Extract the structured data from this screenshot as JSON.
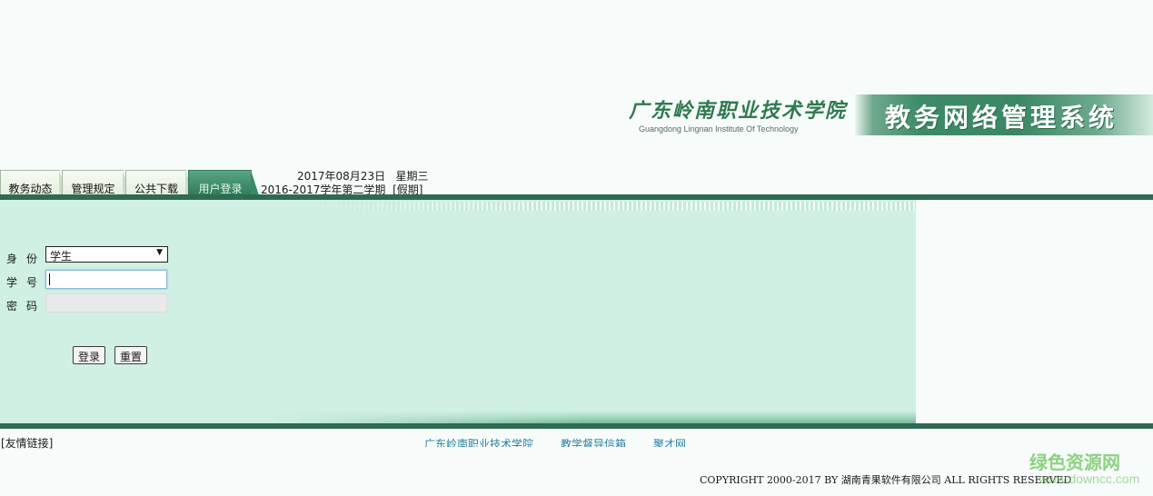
{
  "header": {
    "school_name": "广东岭南职业技术学院",
    "school_name_en": "Guangdong Lingnan Institute Of Technology",
    "system_title": "教务网络管理系统"
  },
  "nav": {
    "tabs": [
      {
        "label": "教务动态",
        "active": false
      },
      {
        "label": "管理规定",
        "active": false
      },
      {
        "label": "公共下载",
        "active": false
      },
      {
        "label": "用户登录",
        "active": true
      }
    ],
    "date": "2017年08月23日",
    "weekday": "星期三",
    "term": "2016-2017学年第二学期",
    "term_status": "[假期]"
  },
  "login": {
    "identity_label": "身份",
    "identity_value": "学生",
    "student_id_label": "学号",
    "student_id_value": "",
    "password_label": "密码",
    "password_value": "",
    "login_button": "登录",
    "reset_button": "重置"
  },
  "footer": {
    "friend_links_label": "[友情链接]",
    "links": [
      "广东岭南职业技术学院",
      "教学督导信箱",
      "聚才网"
    ],
    "copyright_prefix": "COPYRIGHT 2000-2017 BY ",
    "copyright_company": "湖南青果软件有限公司",
    "copyright_suffix": " ALL RIGHTS RESERVED"
  },
  "watermark": {
    "name": "绿色资源网",
    "url": "www.downcc.com"
  },
  "colors": {
    "brand_green": "#2f7a4e",
    "panel_bg": "#cff0e2",
    "bar_dark": "#2e6b52",
    "link_blue": "#2d7fa0"
  }
}
